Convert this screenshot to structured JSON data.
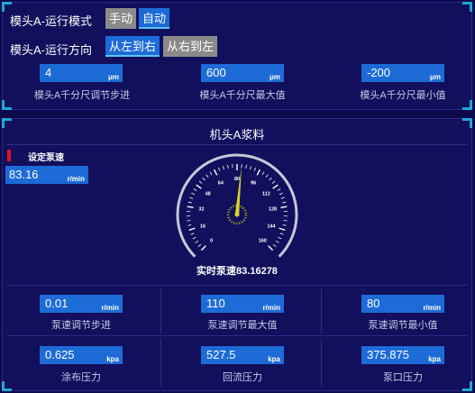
{
  "top": {
    "mode_label": "模头A-运行模式",
    "mode_manual": "手动",
    "mode_auto": "自动",
    "dir_label": "模头A-运行方向",
    "dir_ltr": "从左到右",
    "dir_rtl": "从右到左",
    "fields": [
      {
        "value": "4",
        "unit": "μm",
        "caption": "模头A千分尺调节步进"
      },
      {
        "value": "600",
        "unit": "μm",
        "caption": "模头A千分尺最大值"
      },
      {
        "value": "-200",
        "unit": "μm",
        "caption": "模头A千分尺最小值"
      }
    ]
  },
  "slurry": {
    "title": "机头A浆料",
    "set_speed_label": "设定泵速",
    "set_speed_value": "83.16",
    "set_speed_unit": "r/min",
    "gauge": {
      "ticks": [
        "0",
        "16",
        "32",
        "48",
        "64",
        "80",
        "96",
        "112",
        "128",
        "144",
        "160"
      ],
      "value": 83.16278,
      "min": 0,
      "max": 160
    },
    "realtime_label": "实时泵速83.16278",
    "row1": [
      {
        "value": "0.01",
        "unit": "r/min",
        "caption": "泵速调节步进"
      },
      {
        "value": "110",
        "unit": "r/min",
        "caption": "泵速调节最大值"
      },
      {
        "value": "80",
        "unit": "r/min",
        "caption": "泵速调节最小值"
      }
    ],
    "row2": [
      {
        "value": "0.625",
        "unit": "kpa",
        "caption": "涂布压力"
      },
      {
        "value": "527.5",
        "unit": "kpa",
        "caption": "回流压力"
      },
      {
        "value": "375.875",
        "unit": "kpa",
        "caption": "泵口压力"
      }
    ]
  },
  "colors": {
    "accent": "#1d6bd6",
    "needle": "#d4d42a",
    "corner": "#1fa7d6",
    "marker": "#e0141e"
  }
}
